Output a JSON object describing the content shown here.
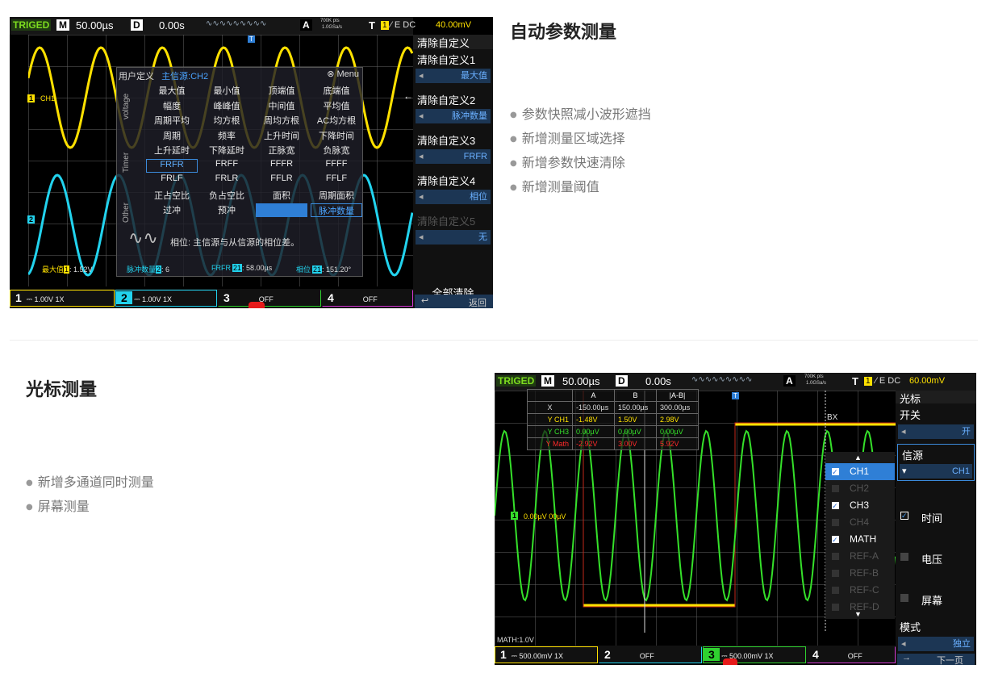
{
  "section1": {
    "heading": "自动参数测量",
    "bullets": [
      "参数快照减小波形遮挡",
      "新增测量区域选择",
      "新增参数快速清除",
      "新增测量阈值"
    ]
  },
  "section2": {
    "heading": "光标测量",
    "bullets": [
      "新增多通道同时测量",
      "屏幕测量"
    ]
  },
  "scope1": {
    "topbar": {
      "status": "TRIGED",
      "m_label": "M",
      "m_value": "50.00µs",
      "d_label": "D",
      "d_value": "0.00s",
      "wave": "∿∿∿∿∿∿∿∿∿",
      "a_label": "A",
      "sampling1": "700K pts",
      "sampling2": "1.0GSa/s",
      "t_label": "T",
      "t_ch": "1",
      "trigger": "⁄ E DC",
      "trigger_level": "40.00mV"
    },
    "markers": {
      "ch1": "1",
      "ch1_name": "CH1",
      "ch2": "2",
      "trig": "T"
    },
    "overlay": {
      "title": "用户定义",
      "source": "主信源:CH2",
      "menu": "Menu",
      "groups": [
        "voltage",
        "Timer",
        "Other"
      ],
      "rows": [
        [
          "最大值",
          "最小值",
          "顶端值",
          "底端值"
        ],
        [
          "幅度",
          "峰峰值",
          "中间值",
          "平均值"
        ],
        [
          "周期平均",
          "均方根",
          "周均方根",
          "AC均方根"
        ],
        [
          "周期",
          "频率",
          "上升时间",
          "下降时间"
        ],
        [
          "上升延时",
          "下降延时",
          "正脉宽",
          "负脉宽"
        ],
        [
          "FRFR",
          "FRFF",
          "FFFR",
          "FFFF"
        ],
        [
          "FRLF",
          "FRLR",
          "FFLR",
          "FFLF"
        ],
        [
          "正占空比",
          "负占空比",
          "面积",
          "周期面积"
        ],
        [
          "过冲",
          "预冲",
          "",
          "脉冲数量"
        ]
      ],
      "description": "相位: 主信源与从信源的相位差。"
    },
    "measures": [
      {
        "label": "最大值",
        "ch": "1",
        "value": ": 1.52V"
      },
      {
        "label": "脉冲数量",
        "ch": "2",
        "value": ": 6"
      },
      {
        "label": "FRFR",
        "ch": "21",
        "value": ": 58.00µs"
      },
      {
        "label": "相位",
        "ch": "21",
        "value": ": 151.20°"
      }
    ],
    "sidemenu": {
      "title": "清除自定义",
      "items": [
        {
          "label": "清除自定义1",
          "value": "最大值"
        },
        {
          "label": "清除自定义2",
          "value": "脉冲数量"
        },
        {
          "label": "清除自定义3",
          "value": "FRFR"
        },
        {
          "label": "清除自定义4",
          "value": "相位"
        },
        {
          "label": "清除自定义5",
          "value": "无"
        }
      ],
      "clear_all": "全部清除",
      "back": "返回"
    },
    "channels": [
      {
        "num": "1",
        "text": "1.00V  1X",
        "color": "#ffe100"
      },
      {
        "num": "2",
        "text": "1.00V  1X",
        "color": "#22d3ee"
      },
      {
        "num": "3",
        "text": "OFF",
        "color": "#2fd12f"
      },
      {
        "num": "4",
        "text": "OFF",
        "color": "#d63ad6"
      }
    ],
    "colors": {
      "ch1": "#ffe100",
      "ch2": "#22d3ee"
    }
  },
  "scope2": {
    "topbar": {
      "status": "TRIGED",
      "m_label": "M",
      "m_value": "50.00µs",
      "d_label": "D",
      "d_value": "0.00s",
      "wave": "∿∿∿∿∿∿∿∿∿",
      "a_label": "A",
      "sampling1": "700K pts",
      "sampling2": "1.0GSa/s",
      "t_label": "T",
      "t_ch": "1",
      "trigger": "⁄ E DC",
      "trigger_level": "60.00mV"
    },
    "table": {
      "headers": [
        "",
        "A",
        "B",
        "|A-B|"
      ],
      "rows": [
        [
          "X",
          "-150.00µs",
          "150.00µs",
          "300.00µs"
        ],
        [
          "Y CH1",
          "-1.48V",
          "1.50V",
          "2.98V"
        ],
        [
          "Y CH3",
          "0.00µV",
          "0.00µV",
          "0.00µV"
        ],
        [
          "Y Math",
          "-2.92V",
          "3.00V",
          "5.92V"
        ]
      ]
    },
    "bx_label": "BX",
    "ch1_marker": "1",
    "ch_readout": "0.00µV 00µV",
    "math_label": "MATH:1.0V",
    "source_list": [
      {
        "name": "CH1",
        "checked": true,
        "enabled": true,
        "selected": true
      },
      {
        "name": "CH2",
        "checked": false,
        "enabled": false,
        "selected": false
      },
      {
        "name": "CH3",
        "checked": true,
        "enabled": true,
        "selected": false
      },
      {
        "name": "CH4",
        "checked": false,
        "enabled": false,
        "selected": false
      },
      {
        "name": "MATH",
        "checked": true,
        "enabled": true,
        "selected": false
      },
      {
        "name": "REF-A",
        "checked": false,
        "enabled": false,
        "selected": false
      },
      {
        "name": "REF-B",
        "checked": false,
        "enabled": false,
        "selected": false
      },
      {
        "name": "REF-C",
        "checked": false,
        "enabled": false,
        "selected": false
      },
      {
        "name": "REF-D",
        "checked": false,
        "enabled": false,
        "selected": false
      }
    ],
    "sidemenu": {
      "title": "光标",
      "switch_label": "开关",
      "switch_value": "开",
      "source_label": "信源",
      "source_value": "CH1",
      "time": "时间",
      "voltage": "电压",
      "screen": "屏幕",
      "mode_label": "模式",
      "mode_value": "独立",
      "next": "下一页"
    },
    "channels": [
      {
        "num": "1",
        "text": "500.00mV  1X",
        "color": "#ffe100"
      },
      {
        "num": "2",
        "text": "OFF",
        "color": "#22d3ee"
      },
      {
        "num": "3",
        "text": "500.00mV  1X",
        "color": "#2fd12f"
      },
      {
        "num": "4",
        "text": "OFF",
        "color": "#d63ad6"
      }
    ]
  }
}
